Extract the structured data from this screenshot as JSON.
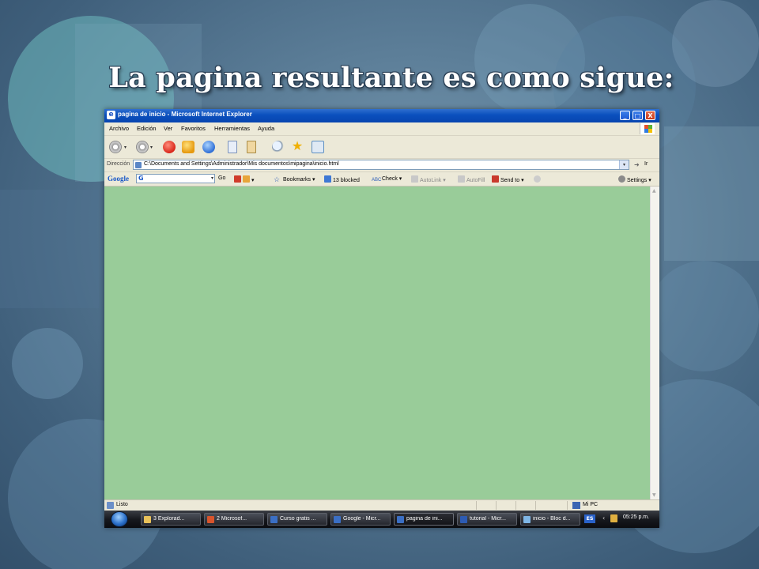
{
  "slide": {
    "title": "La pagina resultante es como sigue:"
  },
  "window": {
    "title": "pagina de inicio - Microsoft Internet Explorer",
    "controls": {
      "minimize": "_",
      "maximize": "□",
      "close": "X"
    }
  },
  "menu": {
    "items": [
      "Archivo",
      "Edición",
      "Ver",
      "Favoritos",
      "Herramientas",
      "Ayuda"
    ]
  },
  "toolbar": {
    "icons": [
      "back-icon",
      "forward-icon",
      "stop-icon",
      "refresh-icon",
      "home-icon",
      "copy-icon",
      "paste-icon",
      "search-icon",
      "favorites-icon",
      "history-icon"
    ]
  },
  "address": {
    "label": "Dirección",
    "value": "C:\\Documents and Settings\\Administrador\\Mis documentos\\mipagina\\inicio.html",
    "go_label": "Ir"
  },
  "google_toolbar": {
    "logo": "Google",
    "field_prefix": "G",
    "go": "Go",
    "bookmarks": "Bookmarks",
    "blocked": "13 blocked",
    "check": "Check",
    "autolink": "AutoLink",
    "autofill": "AutoFill",
    "sendto": "Send to",
    "settings": "Settings"
  },
  "page": {
    "background_color": "#99cc99"
  },
  "status": {
    "text": "Listo",
    "zone": "Mi PC"
  },
  "taskbar": {
    "tasks": [
      {
        "label": "3 Explorad...",
        "color": "#e8c15a"
      },
      {
        "label": "2 Microsof...",
        "color": "#d9542c"
      },
      {
        "label": "Curso gratis ...",
        "color": "#3b6fc4"
      },
      {
        "label": "Google - Micr...",
        "color": "#3b6fc4"
      },
      {
        "label": "pagina de ini...",
        "color": "#3b6fc4"
      },
      {
        "label": "tutorial - Micr...",
        "color": "#2d5bb3"
      },
      {
        "label": "inicio - Bloc d...",
        "color": "#7fb6e6"
      }
    ],
    "language": "ES",
    "clock": "05:25 p.m."
  }
}
